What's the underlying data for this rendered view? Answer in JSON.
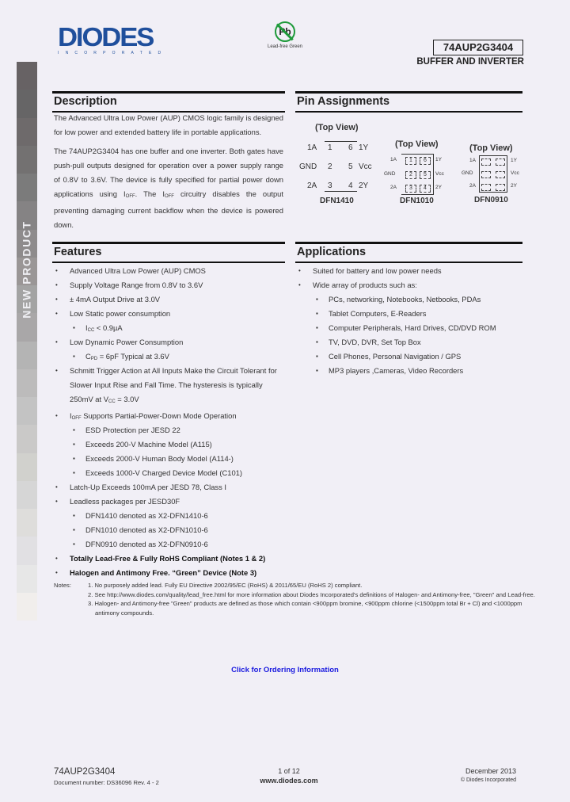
{
  "sidebar": {
    "label": "NEW PRODUCT",
    "bands": [
      "#676264",
      "#666566",
      "#6e6a6b",
      "#737171",
      "#7b7b7b",
      "#858384",
      "#8e8b8c",
      "#9a9696",
      "#a3a3a3",
      "#a9a7a8",
      "#b4b4b4",
      "#bcbbbb",
      "#c3c3c3",
      "#cac9c8",
      "#d1d1cd",
      "#d6d6d6",
      "#dedddb",
      "#e1e0e3",
      "#e7e7e7",
      "#f1eeec"
    ]
  },
  "header": {
    "logo_word": "DIODES",
    "logo_sub": "INCORPORATED",
    "badge_symbol": "Pb",
    "badge_text": "Lead-free Green",
    "part_number": "74AUP2G3404",
    "subtitle": "BUFFER AND INVERTER"
  },
  "description": {
    "title": "Description",
    "paragraphs": [
      "The Advanced Ultra Low Power (AUP) CMOS logic family is designed for low power and extended battery life in portable applications.",
      "The 74AUP2G3404 has one buffer and one inverter. Both gates have push-pull outputs designed for operation over a power supply range of 0.8V to 3.6V.  The device is fully specified for partial power down applications using I_OFF. The I_OFF circuitry disables the output preventing damaging current backflow when the device is powered down."
    ]
  },
  "pins": {
    "title": "Pin Assignments",
    "packages": [
      {
        "view": "(Top View)",
        "name": "DFN1410",
        "left": [
          "1A",
          "GND",
          "2A"
        ],
        "right": [
          "1Y",
          "Vcc",
          "2Y"
        ],
        "left_nums": [
          "1",
          "2",
          "3"
        ],
        "right_nums": [
          "6",
          "5",
          "4"
        ]
      },
      {
        "view": "(Top View)",
        "name": "DFN1010",
        "left": [
          "1A",
          "GND",
          "2A"
        ],
        "right": [
          "1Y",
          "Vcc",
          "2Y"
        ],
        "left_nums": [
          "1",
          "2",
          "3"
        ],
        "right_nums": [
          "6",
          "5",
          "4"
        ]
      },
      {
        "view": "(Top View)",
        "name": "DFN0910",
        "left": [
          "1A",
          "GND",
          "2A"
        ],
        "right": [
          "1Y",
          "Vcc",
          "2Y"
        ],
        "left_nums": [
          "1",
          "2",
          "3"
        ],
        "right_nums": [
          "6",
          "5",
          "4"
        ]
      }
    ]
  },
  "features": {
    "title": "Features",
    "items": [
      {
        "text": "Advanced Ultra Low Power (AUP) CMOS",
        "level": 1
      },
      {
        "text": "Supply Voltage Range from 0.8V  to 3.6V",
        "level": 1
      },
      {
        "text": "± 4mA Output Drive at  3.0V",
        "level": 1
      },
      {
        "text": "Low  Static power consumption",
        "level": 1
      },
      {
        "text": "I_CC < 0.9µA",
        "level": 2
      },
      {
        "text": "Low Dynamic Power Consumption",
        "level": 1
      },
      {
        "text": "C_PD = 6pF Typical at 3.6V",
        "level": 2
      },
      {
        "text": "Schmitt Trigger Action at All Inputs Make the Circuit Tolerant for Slower Input Rise and Fall Time.  The hysteresis is typically 250mV at  V_CC = 3.0V",
        "level": 1
      },
      {
        "text": "I_OFF Supports Partial-Power-Down Mode Operation",
        "level": 1
      },
      {
        "text": "ESD Protection per JESD 22",
        "level": 2
      },
      {
        "text": "Exceeds 200-V Machine Model (A115)",
        "level": 2
      },
      {
        "text": "Exceeds 2000-V Human Body Model (A114-)",
        "level": 2
      },
      {
        "text": "Exceeds 1000-V Charged Device Model (C101)",
        "level": 2
      },
      {
        "text": "Latch-Up Exceeds 100mA per JESD 78, Class I",
        "level": 1
      },
      {
        "text": "Leadless packages per JESD30F",
        "level": 1
      },
      {
        "text": "DFN1410 denoted as X2-DFN1410-6",
        "level": 2
      },
      {
        "text": "DFN1010 denoted as X2-DFN1010-6",
        "level": 2
      },
      {
        "text": "DFN0910 denoted as X2-DFN0910-6",
        "level": 2
      },
      {
        "text": "Totally Lead-Free & Fully RoHS Compliant (Notes 1 & 2)",
        "level": 1,
        "bold": true
      },
      {
        "text": "Halogen and Antimony Free. “Green” Device (Note 3)",
        "level": 1,
        "bold": true
      }
    ]
  },
  "applications": {
    "title": "Applications",
    "items": [
      {
        "text": "Suited for battery and low power needs",
        "level": 1
      },
      {
        "text": "Wide array of products such as:",
        "level": 1
      },
      {
        "text": "PCs, networking, Notebooks, Netbooks, PDAs",
        "level": 2
      },
      {
        "text": "Tablet Computers, E-Readers",
        "level": 2
      },
      {
        "text": "Computer Peripherals, Hard Drives, CD/DVD ROM",
        "level": 2
      },
      {
        "text": "TV, DVD, DVR, Set Top Box",
        "level": 2
      },
      {
        "text": "Cell Phones, Personal Navigation / GPS",
        "level": 2
      },
      {
        "text": "MP3 players ,Cameras, Video Recorders",
        "level": 2
      }
    ]
  },
  "notes": {
    "label": "Notes:",
    "items": [
      "1. No purposely added lead. Fully EU Directive 2002/95/EC (RoHS) & 2011/65/EU (RoHS 2) compliant.",
      "2. See http://www.diodes.com/quality/lead_free.html for more information about Diodes Incorporated's definitions of Halogen- and Antimony-free, \"Green\" and Lead-free.",
      "3. Halogen- and Antimony-free \"Green\" products are defined as those which contain <900ppm bromine, <900ppm chlorine (<1500ppm total Br + Cl) and <1000ppm antimony compounds."
    ]
  },
  "ordering_link": "Click for Ordering Information",
  "footer": {
    "part": "74AUP2G3404",
    "doc_number": "Document number: DS36096  Rev. 4 - 2",
    "page": "1 of 12",
    "website": "www.diodes.com",
    "date": "December 2013",
    "copyright": "© Diodes Incorporated"
  }
}
